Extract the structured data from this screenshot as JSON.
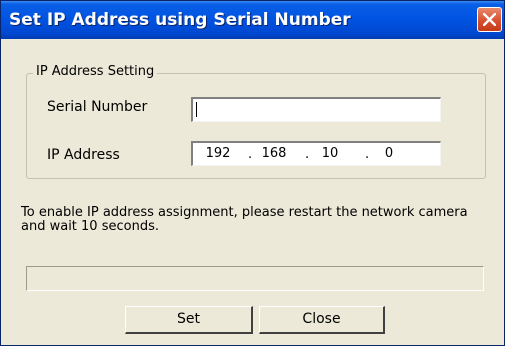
{
  "window": {
    "title": "Set IP Address using Serial Number"
  },
  "ip_setting": {
    "group_label": "IP Address Setting",
    "serial_label": "Serial Number",
    "serial_value": "",
    "ip_label": "IP Address",
    "ip_octets": [
      "192",
      "168",
      "10",
      "0"
    ],
    "separator": "."
  },
  "message": "To enable IP address assignment, please restart the network camera and wait  10 seconds.",
  "progress": {
    "value": 0
  },
  "buttons": {
    "set": "Set",
    "close": "Close"
  },
  "icons": {
    "close": "close-x-icon"
  },
  "colors": {
    "titlebar": "#0054e3",
    "close_button": "#d8502f",
    "face": "#ece9d8"
  }
}
